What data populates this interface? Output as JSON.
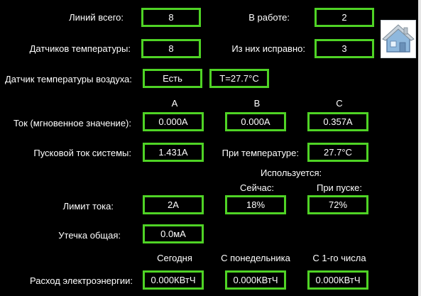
{
  "lines": {
    "total_label": "Линий всего:",
    "total_value": "8",
    "working_label": "В работе:",
    "working_value": "2"
  },
  "sensors": {
    "count_label": "Датчиков температуры:",
    "count_value": "8",
    "ok_label": "Из них исправно:",
    "ok_value": "3"
  },
  "air_sensor": {
    "label": "Датчик температуры воздуха:",
    "status": "Есть",
    "temp": "T=27.7°C"
  },
  "phases": {
    "a": "A",
    "b": "B",
    "c": "C"
  },
  "current": {
    "label": "Ток (мгновенное значение):",
    "a": "0.000A",
    "b": "0.000A",
    "c": "0.357A"
  },
  "startup": {
    "label": "Пусковой ток системы:",
    "value": "1.431A",
    "temp_label": "При температуре:",
    "temp_value": "27.7°C"
  },
  "usage": {
    "header": "Используется:",
    "now_label": "Сейчас:",
    "start_label": "При пуске:"
  },
  "limit": {
    "label": "Лимит тока:",
    "value": "2A",
    "now": "18%",
    "start": "72%"
  },
  "leak": {
    "label": "Утечка общая:",
    "value": "0.0мA"
  },
  "energy": {
    "today_label": "Сегодня",
    "monday_label": "С понедельника",
    "month_label": "С 1-го числа",
    "label": "Расход электроэнергии:",
    "today": "0.000КВтЧ",
    "monday": "0.000КВтЧ",
    "month": "0.000КВтЧ"
  },
  "colors": {
    "accent": "#4fd325",
    "background": "#000000",
    "text": "#ffffff"
  },
  "icons": {
    "home": "home-icon"
  }
}
